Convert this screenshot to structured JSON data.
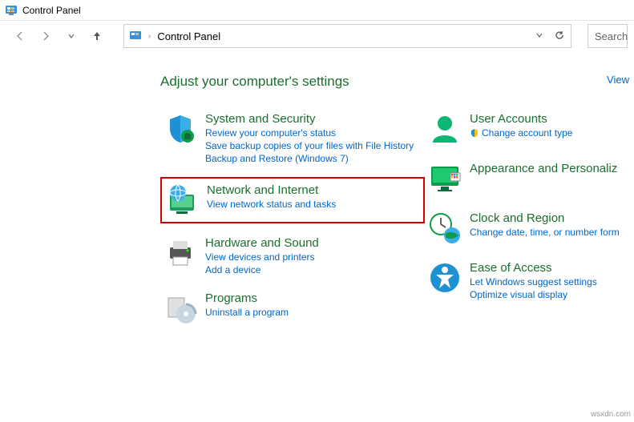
{
  "window": {
    "title": "Control Panel"
  },
  "address": {
    "text": "Control Panel"
  },
  "search": {
    "placeholder": "Search"
  },
  "heading": "Adjust your computer's settings",
  "view_link": "View",
  "categories": {
    "system": {
      "title": "System and Security",
      "links": [
        "Review your computer's status",
        "Save backup copies of your files with File History",
        "Backup and Restore (Windows 7)"
      ]
    },
    "network": {
      "title": "Network and Internet",
      "links": [
        "View network status and tasks"
      ]
    },
    "hardware": {
      "title": "Hardware and Sound",
      "links": [
        "View devices and printers",
        "Add a device"
      ]
    },
    "programs": {
      "title": "Programs",
      "links": [
        "Uninstall a program"
      ]
    },
    "users": {
      "title": "User Accounts",
      "links": [
        "Change account type"
      ]
    },
    "appearance": {
      "title": "Appearance and Personaliz"
    },
    "clock": {
      "title": "Clock and Region",
      "links": [
        "Change date, time, or number form"
      ]
    },
    "ease": {
      "title": "Ease of Access",
      "links": [
        "Let Windows suggest settings",
        "Optimize visual display"
      ]
    }
  },
  "watermark": "wsxdn.com"
}
